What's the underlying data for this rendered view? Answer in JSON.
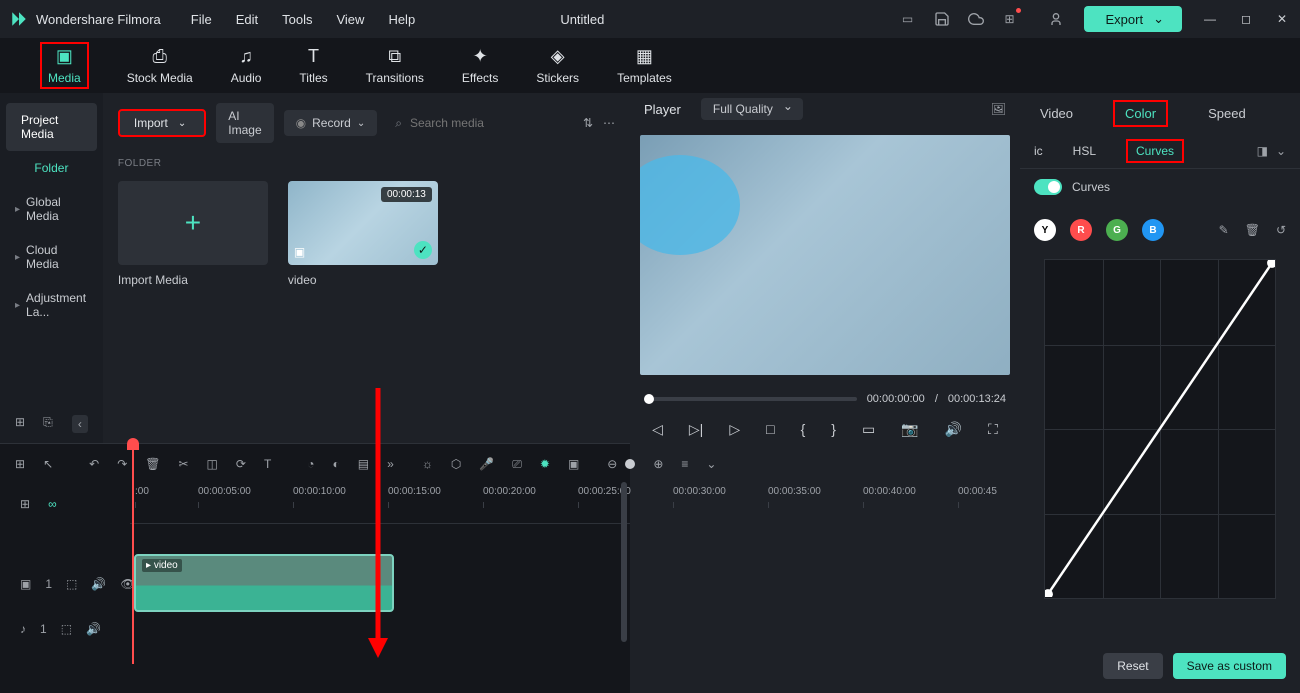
{
  "app": {
    "name": "Wondershare Filmora",
    "document": "Untitled",
    "export_label": "Export"
  },
  "menu": [
    "File",
    "Edit",
    "Tools",
    "View",
    "Help"
  ],
  "nav": [
    {
      "label": "Media",
      "active": true
    },
    {
      "label": "Stock Media"
    },
    {
      "label": "Audio"
    },
    {
      "label": "Titles"
    },
    {
      "label": "Transitions"
    },
    {
      "label": "Effects"
    },
    {
      "label": "Stickers"
    },
    {
      "label": "Templates"
    }
  ],
  "sidebar": {
    "items": [
      {
        "label": "Project Media",
        "active": true
      },
      {
        "label": "Folder",
        "accent": true
      },
      {
        "label": "Global Media",
        "caret": true
      },
      {
        "label": "Cloud Media",
        "caret": true
      },
      {
        "label": "Adjustment La...",
        "caret": true
      }
    ]
  },
  "media": {
    "import_label": "Import",
    "ai_image_label": "AI Image",
    "record_label": "Record",
    "search_placeholder": "Search media",
    "section_label": "FOLDER",
    "cards": [
      {
        "label": "Import Media",
        "type": "add"
      },
      {
        "label": "video",
        "type": "video",
        "duration": "00:00:13"
      }
    ]
  },
  "preview": {
    "player_label": "Player",
    "quality": "Full Quality",
    "time_current": "00:00:00:00",
    "time_sep": "/",
    "time_total": "00:00:13:24"
  },
  "right": {
    "tabs": [
      "Video",
      "Color",
      "Speed"
    ],
    "active_tab": "Color",
    "subtabs": [
      "ic",
      "HSL",
      "Curves"
    ],
    "active_subtab": "Curves",
    "curves_label": "Curves",
    "channels": [
      "Y",
      "R",
      "G",
      "B"
    ],
    "reset_label": "Reset",
    "save_label": "Save as custom"
  },
  "timeline": {
    "ticks": [
      ":00",
      "00:00:05:00",
      "00:00:10:00",
      "00:00:15:00",
      "00:00:20:00",
      "00:00:25:00",
      "00:00:30:00",
      "00:00:35:00",
      "00:00:40:00",
      "00:00:45"
    ],
    "clip_label": "video",
    "video_track_label": "1",
    "audio_track_label": "1"
  },
  "colors": {
    "accent": "#4de3c1",
    "highlight": "#ff0000"
  }
}
